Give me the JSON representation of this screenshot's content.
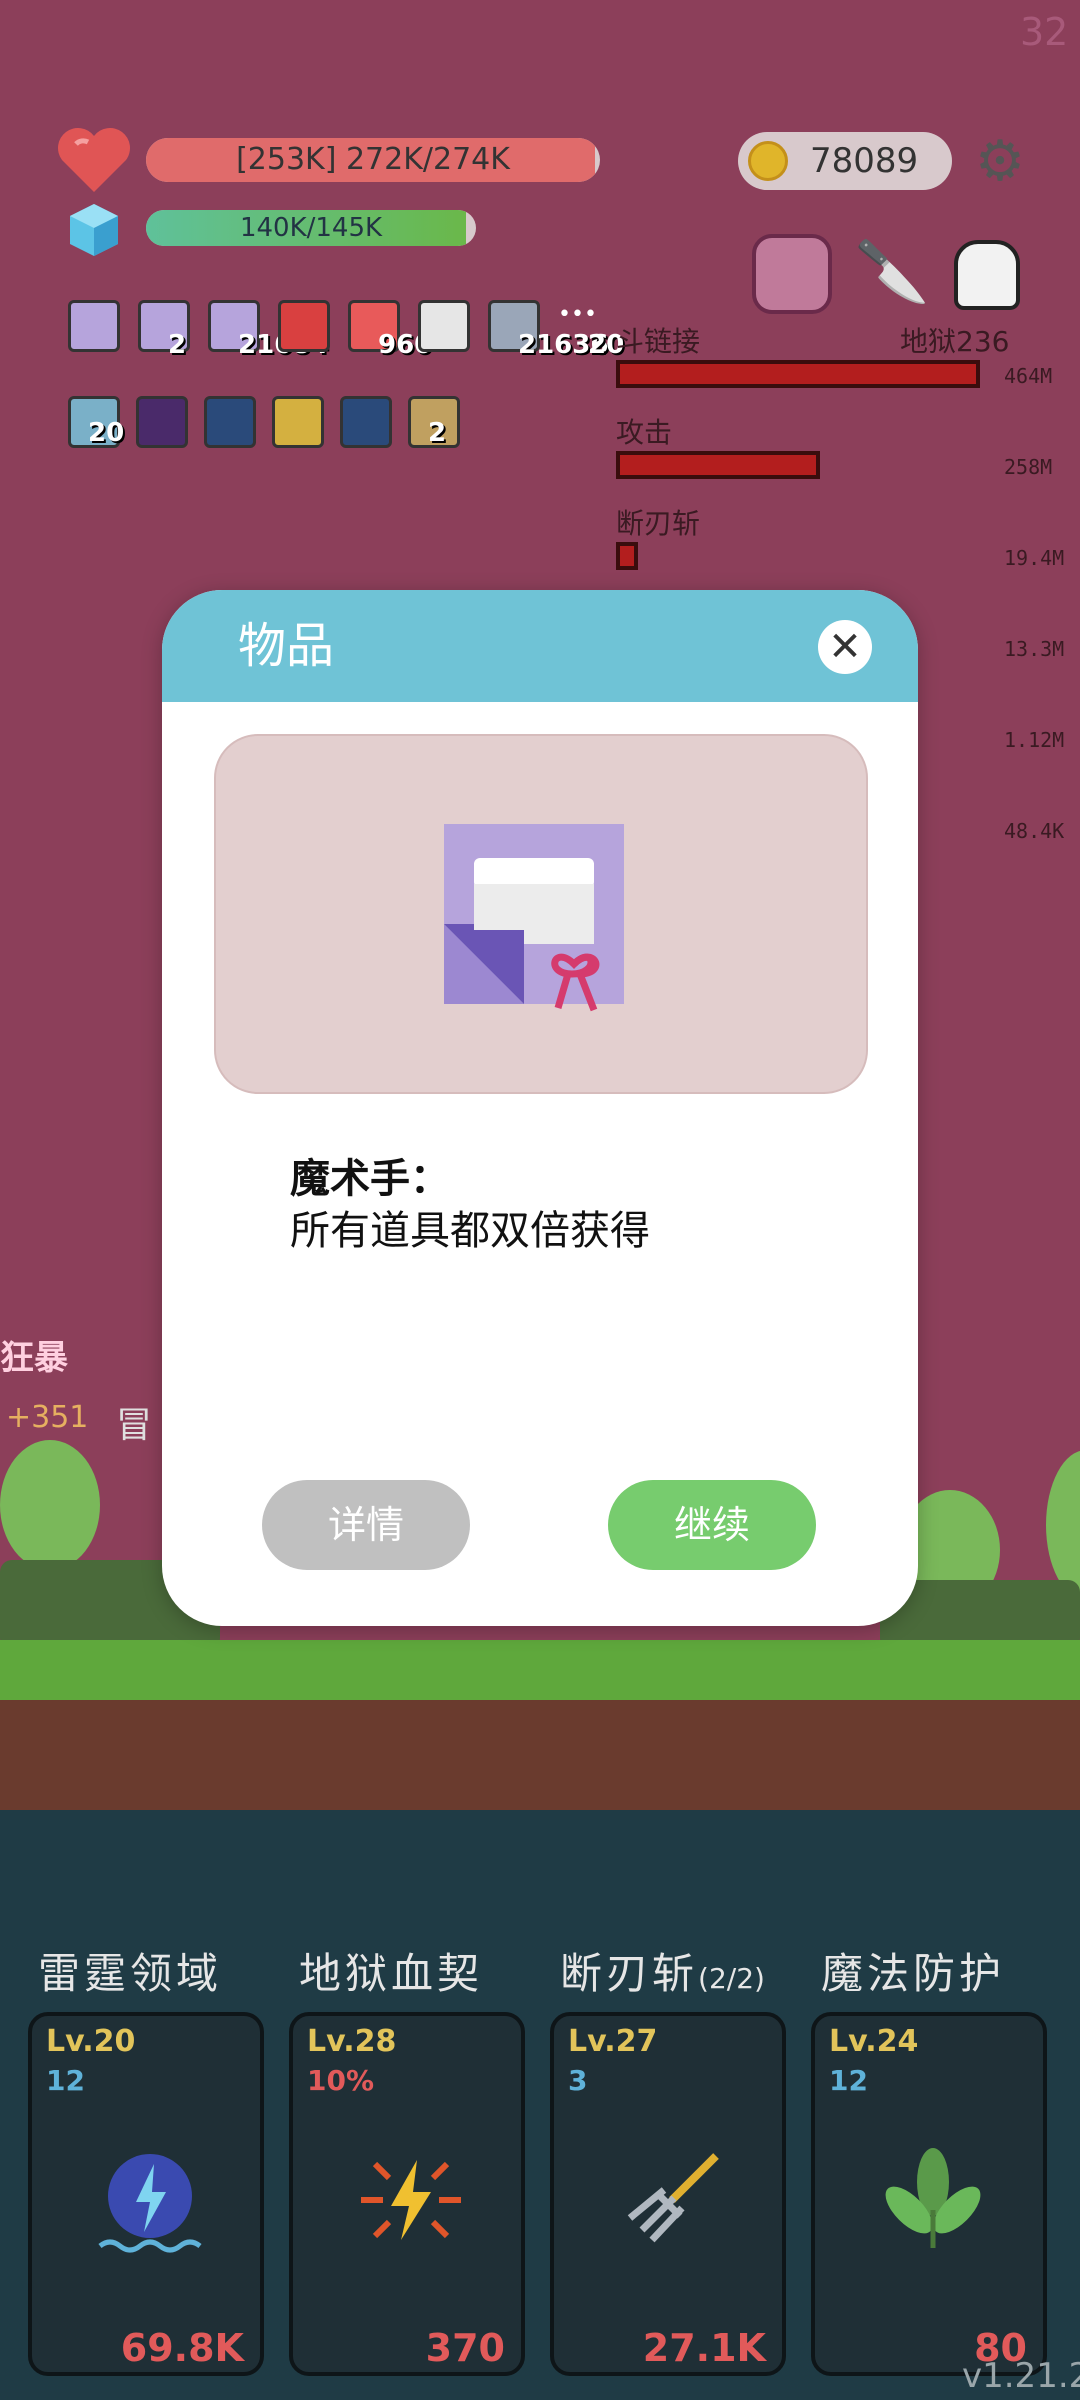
{
  "hud": {
    "fps": "32",
    "hp_text": "[253K] 272K/274K",
    "hp_fraction": 0.99,
    "mp_text": "140K/145K",
    "mp_fraction": 0.97,
    "coins": "78089"
  },
  "items": [
    {
      "icon": "magic-hand-icon",
      "count": ""
    },
    {
      "icon": "magic-hand-icon",
      "count": "2"
    },
    {
      "icon": "magic-hand-icon",
      "count": "21684"
    },
    {
      "icon": "apple-icon",
      "count": ""
    },
    {
      "icon": "pill-icon",
      "count": "960"
    },
    {
      "icon": "card-icon",
      "count": ""
    },
    {
      "icon": "sword-icon",
      "count": "21636"
    },
    {
      "icon": "more-icon",
      "count": "20"
    }
  ],
  "buffs": [
    {
      "icon": "rune-icon",
      "count": "20"
    },
    {
      "icon": "demon-icon",
      "count": ""
    },
    {
      "icon": "vortex-icon",
      "count": ""
    },
    {
      "icon": "mask-icon",
      "count": ""
    },
    {
      "icon": "vortex-icon",
      "count": ""
    },
    {
      "icon": "shield-icon",
      "count": "2"
    }
  ],
  "damage": {
    "rows": [
      {
        "label": "斗链接",
        "right": "地狱236",
        "value": "464M",
        "fraction": 1.0
      },
      {
        "label": "攻击",
        "right": "",
        "value": "258M",
        "fraction": 0.56
      },
      {
        "label": "断刃斩",
        "right": "",
        "value": "19.4M",
        "fraction": 0.04
      }
    ],
    "extra_values": [
      "13.3M",
      "1.12M",
      "48.4K"
    ]
  },
  "dialog": {
    "title": "物品",
    "item_name": "魔术手：",
    "item_desc": "所有道具都双倍获得",
    "detail_label": "详情",
    "continue_label": "继续"
  },
  "battle_text": {
    "rage": "狂暴",
    "gain": "+351",
    "adventure": "冒"
  },
  "skills": [
    {
      "name": "雷霆领域",
      "suffix": "",
      "level": "Lv.20",
      "sub": "12",
      "sub_color": "#5fb2d9",
      "cost": "69.8K",
      "icon": "thunder-domain-icon"
    },
    {
      "name": "地狱血契",
      "suffix": "",
      "level": "Lv.28",
      "sub": "10%",
      "sub_color": "#e15a5a",
      "cost": "370",
      "icon": "lightning-burst-icon"
    },
    {
      "name": "断刃斩",
      "suffix": "(2/2)",
      "level": "Lv.27",
      "sub": "3",
      "sub_color": "#5fb2d9",
      "cost": "27.1K",
      "icon": "pitchfork-icon"
    },
    {
      "name": "魔法防护",
      "suffix": "",
      "level": "Lv.24",
      "sub": "12",
      "sub_color": "#5fb2d9",
      "cost": "80",
      "icon": "leaf-icon"
    }
  ],
  "version": "v1.21.2"
}
